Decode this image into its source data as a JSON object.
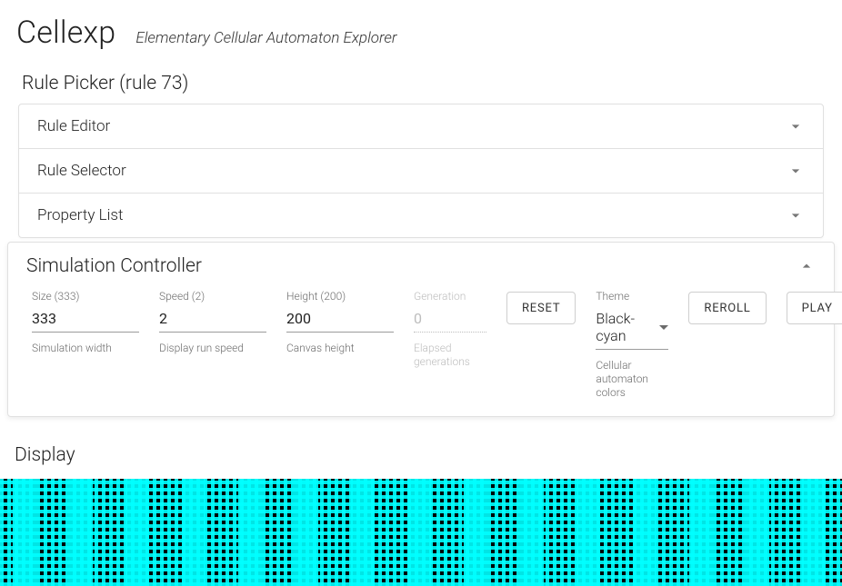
{
  "header": {
    "title": "Cellexp",
    "subtitle": "Elementary Cellular Automaton Explorer"
  },
  "rule_picker": {
    "title": "Rule Picker (rule 73)",
    "panels": {
      "editor": "Rule Editor",
      "selector": "Rule Selector",
      "properties": "Property List"
    }
  },
  "controller": {
    "title": "Simulation Controller",
    "size": {
      "label": "Size (333)",
      "value": "333",
      "help": "Simulation width"
    },
    "speed": {
      "label": "Speed (2)",
      "value": "2",
      "help": "Display run speed"
    },
    "height": {
      "label": "Height (200)",
      "value": "200",
      "help": "Canvas height"
    },
    "generation": {
      "label": "Generation",
      "value": "0",
      "help": "Elapsed generations"
    },
    "reset": "RESET",
    "theme": {
      "label": "Theme",
      "value": "Black-cyan",
      "help": "Cellular automaton colors"
    },
    "reroll": "REROLL",
    "play": "PLAY"
  },
  "display": {
    "title": "Display"
  }
}
